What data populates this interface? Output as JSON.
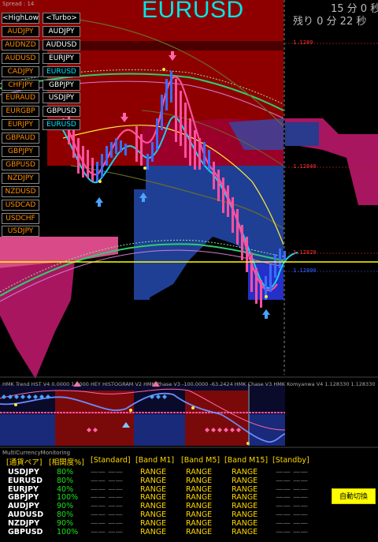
{
  "header": {
    "spread_label": "Spread : 14",
    "symbol": "EURUSD",
    "timer_top": "15 分 0 秒",
    "timer_remaining": "残り 0 分 22 秒"
  },
  "pair_panel": {
    "buttons": [
      {
        "label": "<HighLow>",
        "color": "white"
      },
      {
        "label": "<Turbo>",
        "color": "white"
      },
      {
        "label": "AUDJPY",
        "color": "orange"
      },
      {
        "label": "AUDJPY",
        "color": "white"
      },
      {
        "label": "AUDNZD",
        "color": "orange"
      },
      {
        "label": "AUDUSD",
        "color": "white"
      },
      {
        "label": "AUDUSD",
        "color": "orange"
      },
      {
        "label": "EURJPY",
        "color": "white"
      },
      {
        "label": "CADJPY",
        "color": "orange"
      },
      {
        "label": "EURUSD",
        "color": "cyan"
      },
      {
        "label": "CHFJPY",
        "color": "orange"
      },
      {
        "label": "GBPJPY",
        "color": "white"
      },
      {
        "label": "EURAUD",
        "color": "orange"
      },
      {
        "label": "USDJPY",
        "color": "white"
      },
      {
        "label": "EURGBP",
        "color": "orange"
      },
      {
        "label": "GBPUSD",
        "color": "white"
      },
      {
        "label": "EURJPY",
        "color": "orange"
      },
      {
        "label": "EURUSD",
        "color": "cyan"
      },
      {
        "label": "GBPAUD",
        "color": "orange"
      },
      {
        "label": "GBPJPY",
        "color": "orange"
      },
      {
        "label": "GBPUSD",
        "color": "orange"
      },
      {
        "label": "NZDJPY",
        "color": "orange"
      },
      {
        "label": "NZDUSD",
        "color": "orange"
      },
      {
        "label": "USDCAD",
        "color": "orange"
      },
      {
        "label": "USDCHF",
        "color": "orange"
      },
      {
        "label": "USDJPY",
        "color": "orange"
      }
    ]
  },
  "price_tags": [
    {
      "text": "1.1289",
      "color": "#ff3030"
    },
    {
      "text": "1.12840",
      "color": "#ff3030"
    },
    {
      "text": "1.12820",
      "color": "#ff3030"
    },
    {
      "text": "1.12800",
      "color": "#3060ff"
    }
  ],
  "indicator_label": "HMK Trend HST V4 0.0000 1.0000  HEY HISTOGRAM V2  HMK Phase V3 -100.0000 -63.2424  HMK Chase V3  HMK Komyanwa V4 1.128330 1.128330",
  "monitoring": {
    "title": "MultiCurrencyMonitoring",
    "headers": [
      "[通貨ペア]",
      "[相関度%]",
      "[Standard]",
      "[Band M1]",
      "[Band M5]",
      "[Band M15]",
      "[Standby]"
    ],
    "rows": [
      {
        "pair": "USDJPY",
        "corr": "80%",
        "std": "—— ——",
        "m1": "RANGE",
        "m5": "RANGE",
        "m15": "RANGE",
        "stb": "—— ——"
      },
      {
        "pair": "EURUSD",
        "corr": "80%",
        "std": "—— ——",
        "m1": "RANGE",
        "m5": "RANGE",
        "m15": "RANGE",
        "stb": "—— ——"
      },
      {
        "pair": "EURJPY",
        "corr": "40%",
        "std": "—— ——",
        "m1": "RANGE",
        "m5": "RANGE",
        "m15": "RANGE",
        "stb": "—— ——"
      },
      {
        "pair": "GBPJPY",
        "corr": "100%",
        "std": "—— ——",
        "m1": "RANGE",
        "m5": "RANGE",
        "m15": "RANGE",
        "stb": "—— ——"
      },
      {
        "pair": "AUDJPY",
        "corr": "90%",
        "std": "—— ——",
        "m1": "RANGE",
        "m5": "RANGE",
        "m15": "RANGE",
        "stb": "—— ——"
      },
      {
        "pair": "AUDUSD",
        "corr": "80%",
        "std": "—— ——",
        "m1": "RANGE",
        "m5": "RANGE",
        "m15": "RANGE",
        "stb": "—— ——"
      },
      {
        "pair": "NZDJPY",
        "corr": "90%",
        "std": "—— ——",
        "m1": "RANGE",
        "m5": "RANGE",
        "m15": "RANGE",
        "stb": "—— ——"
      },
      {
        "pair": "GBPUSD",
        "corr": "100%",
        "std": "—— ——",
        "m1": "RANGE",
        "m5": "RANGE",
        "m15": "RANGE",
        "stb": "—— ——"
      }
    ],
    "auto_switch_label": "自動切換"
  },
  "colors": {
    "band_red": "#a00000",
    "band_blue": "#1a3a8c",
    "magenta_cloud": "#b0186a",
    "pink_cloud": "#e0508a",
    "candle_pink": "#ff4fa0",
    "candle_blue": "#3a6cff",
    "cyan_line": "#19d0f0",
    "green_band": "#2ecc71",
    "yellow_line": "#ffeb3b",
    "arrow_blue": "#4aa3ff",
    "arrow_pink": "#ff66aa"
  }
}
